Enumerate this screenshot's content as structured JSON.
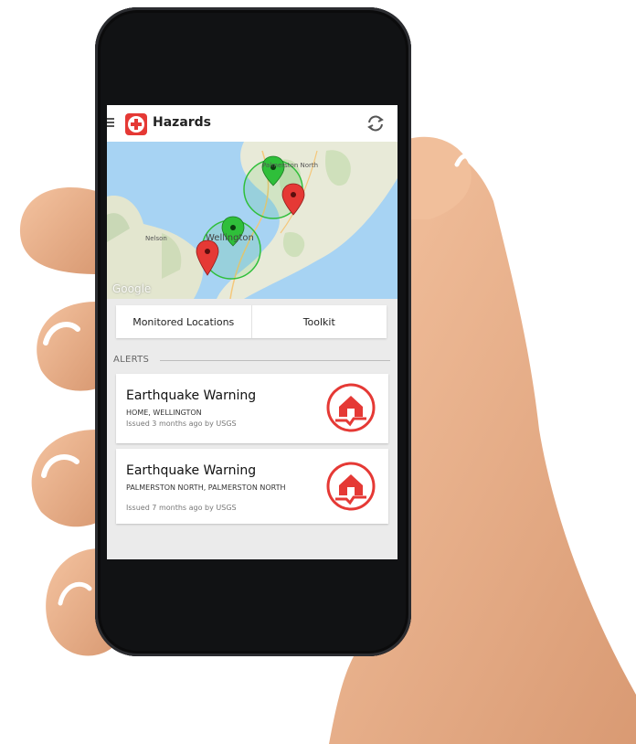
{
  "app": {
    "title": "Hazards",
    "icons": {
      "menu": "hamburger-icon",
      "logo": "red-cross-icon",
      "refresh": "refresh-icon"
    }
  },
  "map": {
    "labels": [
      "Palmerston North",
      "Nelson",
      "Wellington"
    ],
    "attribution": "Google",
    "markers": [
      {
        "label": "green-marker-palmerston",
        "color": "#2fbf3a"
      },
      {
        "label": "red-marker-palmerston",
        "color": "#e53935"
      },
      {
        "label": "green-marker-wellington",
        "color": "#2fbf3a"
      },
      {
        "label": "red-marker-wellington",
        "color": "#e53935"
      }
    ]
  },
  "tabs": [
    {
      "label": "Monitored Locations"
    },
    {
      "label": "Toolkit"
    }
  ],
  "alerts_section": {
    "label": "ALERTS"
  },
  "alerts": [
    {
      "title": "Earthquake Warning",
      "location": "HOME, WELLINGTON",
      "meta": "Issued 3 months ago by USGS",
      "icon": "earthquake-icon"
    },
    {
      "title": "Earthquake Warning",
      "location": "PALMERSTON NORTH, PALMERSTON NORTH",
      "meta": "Issued 7 months ago by USGS",
      "icon": "earthquake-icon"
    }
  ],
  "colors": {
    "accent": "#e53935",
    "map_water": "#a7d3f3",
    "map_land": "#e9ead9",
    "geofence": "#2fbf3a"
  }
}
